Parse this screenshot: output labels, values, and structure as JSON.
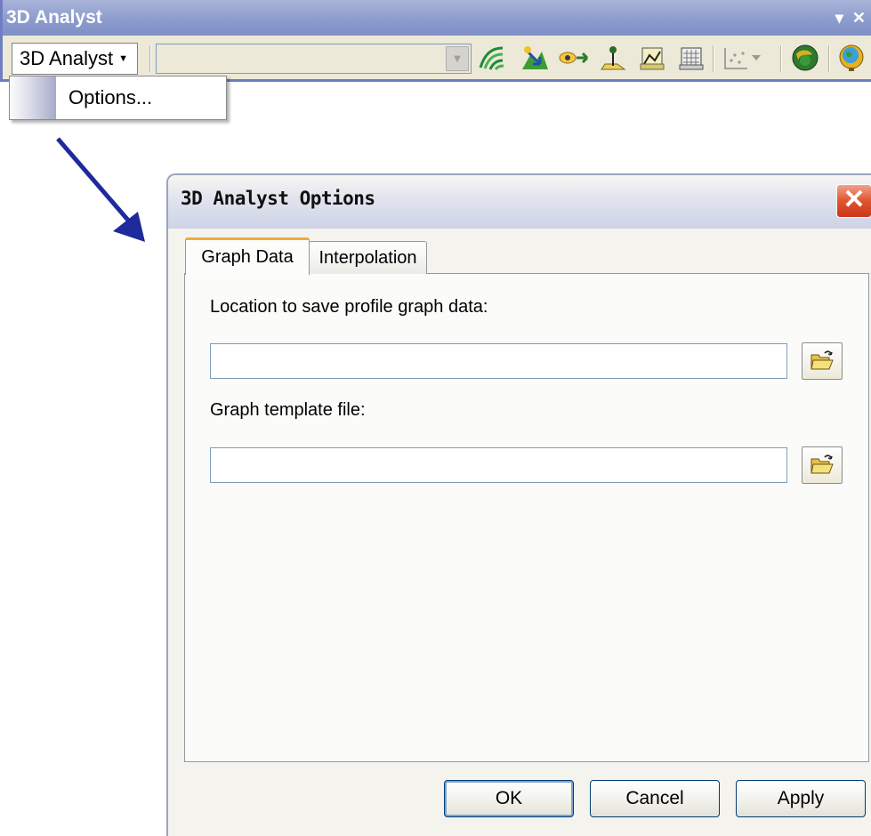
{
  "toolbar": {
    "title": "3D Analyst",
    "title_controls": [
      "▾",
      "✕"
    ],
    "menu_button_label": "3D Analyst",
    "layer_combo_value": "",
    "tools": [
      "contour-icon",
      "steepest-path-icon",
      "line-of-sight-icon",
      "interpolate-point-icon",
      "interpolate-line-icon",
      "interpolate-polygon-icon",
      "create-profile-graph-icon",
      "arcscene-icon",
      "arcglobe-icon"
    ]
  },
  "menu": {
    "items": [
      {
        "label": "Options..."
      }
    ]
  },
  "dialog": {
    "title": "3D Analyst Options",
    "close_glyph": "✕",
    "tabs": [
      {
        "label": "Graph Data",
        "active": true
      },
      {
        "label": "Interpolation",
        "active": false
      }
    ],
    "fields": [
      {
        "label": "Location to save profile graph data:",
        "value": ""
      },
      {
        "label": "Graph template file:",
        "value": ""
      }
    ],
    "buttons": {
      "ok": "OK",
      "cancel": "Cancel",
      "apply": "Apply"
    }
  },
  "colors": {
    "titlebar": "#8d9ccd",
    "arrow": "#1f2a9c",
    "active_tab_accent": "#f2a93b",
    "close_button": "#e0552e"
  }
}
